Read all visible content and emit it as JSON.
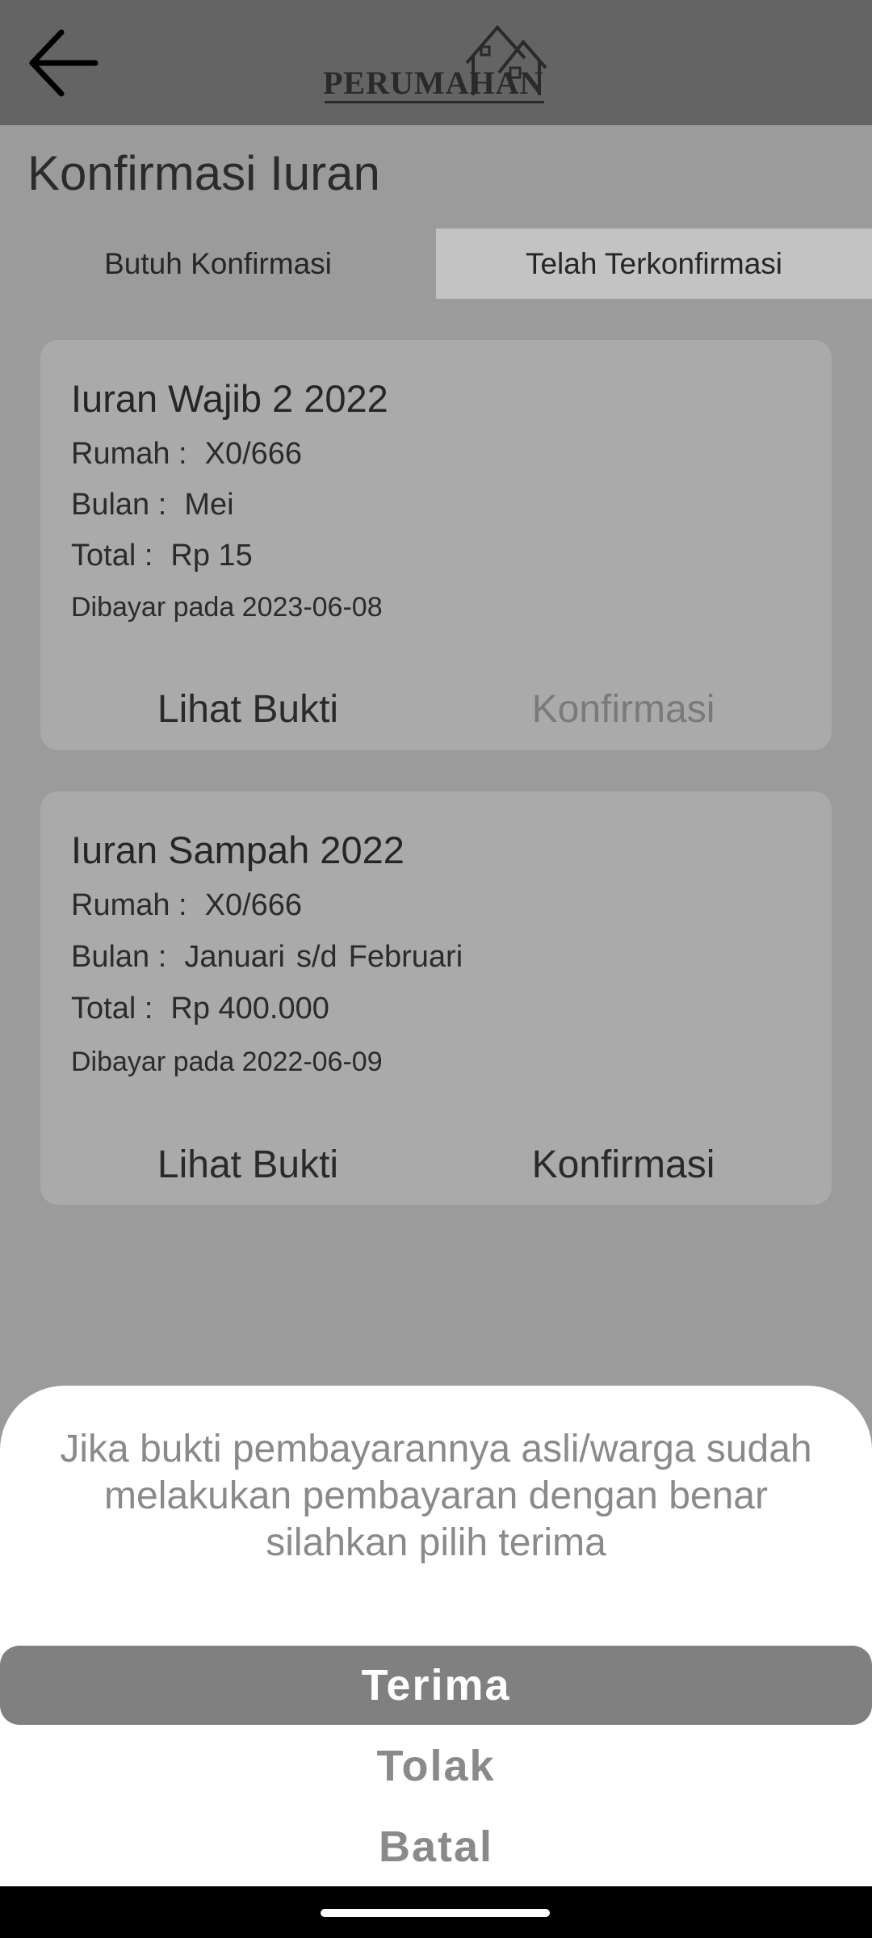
{
  "header": {
    "back_icon": "arrow-left-icon",
    "logo_text": "PERUMAHAN",
    "logo_icon": "house-icon"
  },
  "page_title": "Konfirmasi Iuran",
  "tabs": [
    {
      "label": "Butuh Konfirmasi",
      "selected": true
    },
    {
      "label": "Telah Terkonfirmasi",
      "selected": false
    }
  ],
  "cards": [
    {
      "title": "Iuran Wajib 2 2022",
      "house_label": "Rumah :",
      "house_value": "X0/666",
      "month_label": "Bulan :",
      "month_value": "Mei",
      "total_label": "Total :",
      "total_value": "Rp 15",
      "paid_text": "Dibayar pada 2023-06-08",
      "view_proof": "Lihat Bukti",
      "confirm": "Konfirmasi"
    },
    {
      "title": "Iuran Sampah 2022",
      "house_label": "Rumah :",
      "house_value": "X0/666",
      "month_label": "Bulan :",
      "month_start": "Januari",
      "month_sep": "s/d",
      "month_end": "Februari",
      "total_label": "Total :",
      "total_value": "Rp 400.000",
      "paid_text": "Dibayar pada 2022-06-09",
      "view_proof": "Lihat Bukti",
      "confirm": "Konfirmasi"
    }
  ],
  "bottom_sheet": {
    "message": "Jika bukti pembayarannya asli/warga sudah melakukan pembayaran dengan benar silahkan pilih terima",
    "accept": "Terima",
    "reject": "Tolak",
    "cancel": "Batal"
  },
  "colors": {
    "appbar": "#646464",
    "background": "#9b9b9b",
    "card": "#aaaaaa",
    "accept_button": "#808080"
  }
}
